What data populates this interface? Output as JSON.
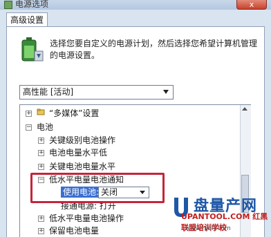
{
  "window": {
    "title": "电源选项",
    "close_label": "x"
  },
  "tab": {
    "label": "高级设置"
  },
  "description": "选择您要自定义的电源计划，然后选择您希望计算机管理的电源设置。",
  "plan_select": {
    "value": "高性能 [活动]"
  },
  "tree": {
    "items": [
      {
        "expander": "+",
        "label": "“多媒体”设置",
        "icon": "folder-icon"
      },
      {
        "expander": "−",
        "label": "电池",
        "icon": "folder-icon"
      },
      {
        "expander": "+",
        "label": "关键级别电池操作",
        "icon": "folder-icon"
      },
      {
        "expander": "+",
        "label": "电池电量水平低",
        "icon": "folder-icon"
      },
      {
        "expander": "+",
        "label": "关键电池电量水平",
        "icon": "folder-icon"
      },
      {
        "expander": "−",
        "label": "低水平电量电池通知",
        "icon": "folder-icon"
      },
      {
        "expander": "",
        "label": "接通电源: 打开",
        "icon": ""
      },
      {
        "expander": "+",
        "label": "低水平电量电池操作",
        "icon": "folder-icon"
      },
      {
        "expander": "+",
        "label": "保留电池电量",
        "icon": "folder-icon"
      }
    ],
    "on_battery": {
      "label": "使用电池:",
      "value": "关闭"
    }
  },
  "watermark": {
    "big": "盘量产网",
    "mid": "UPANTOOL.COM 红黑联盟培训学校",
    "url": "www.hjdn.com"
  }
}
